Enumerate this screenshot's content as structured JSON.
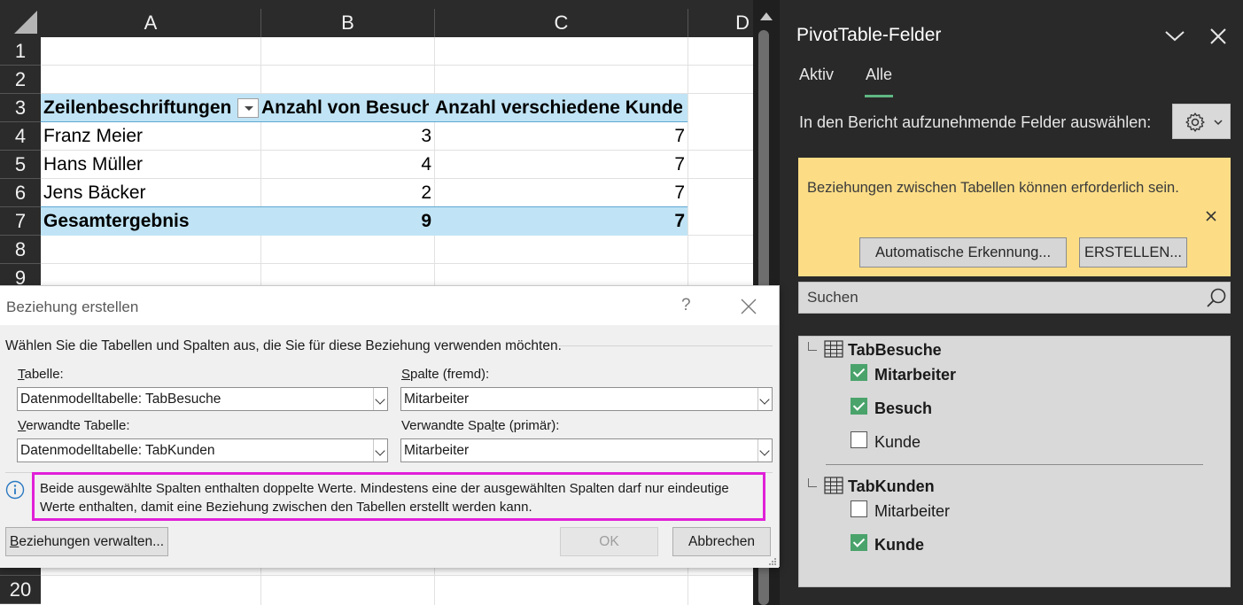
{
  "sheet": {
    "columns": [
      "A",
      "B",
      "C",
      "D"
    ],
    "rows_top": [
      "1",
      "2",
      "3",
      "4",
      "5",
      "6",
      "7",
      "8",
      "9"
    ],
    "rows_bottom": [
      "20"
    ],
    "pivot": {
      "header": [
        "Zeilenbeschriftungen",
        "Anzahl von Besuch",
        "Anzahl verschiedene Kunde"
      ],
      "rows": [
        {
          "name": "Franz Meier",
          "besuch": "3",
          "kunde": "7"
        },
        {
          "name": "Hans Müller",
          "besuch": "4",
          "kunde": "7"
        },
        {
          "name": "Jens Bäcker",
          "besuch": "2",
          "kunde": "7"
        }
      ],
      "total": {
        "name": "Gesamtergebnis",
        "besuch": "9",
        "kunde": "7"
      }
    }
  },
  "pane": {
    "title": "PivotTable-Felder",
    "tabs": [
      "Aktiv",
      "Alle"
    ],
    "active_tab": "Alle",
    "choose_label": "In den Bericht aufzunehmende Felder auswählen:",
    "notice": {
      "text": "Beziehungen zwischen Tabellen können erforderlich sein.",
      "auto_button": "Automatische Erkennung...",
      "create_button": "ERSTELLEN..."
    },
    "search_placeholder": "Suchen",
    "tables": [
      {
        "name": "TabBesuche",
        "fields": [
          {
            "label": "Mitarbeiter",
            "checked": true
          },
          {
            "label": "Besuch",
            "checked": true
          },
          {
            "label": "Kunde",
            "checked": false
          }
        ]
      },
      {
        "name": "TabKunden",
        "fields": [
          {
            "label": "Mitarbeiter",
            "checked": false
          },
          {
            "label": "Kunde",
            "checked": true
          }
        ]
      }
    ],
    "colors": {
      "background": "#292929",
      "notice": "#fcdd86",
      "checkbox_on": "#4aa36b",
      "tab_underline": "#5fb782"
    }
  },
  "dialog": {
    "title": "Beziehung erstellen",
    "help": "?",
    "intro": "Wählen Sie die Tabellen und Spalten aus, die Sie für diese Beziehung verwenden möchten.",
    "table_label_key": "T",
    "table_label_rest": "abelle:",
    "table_value": "Datenmodelltabelle: TabBesuche",
    "column_label_key": "S",
    "column_label_rest": "palte (fremd):",
    "column_value": "Mitarbeiter",
    "rel_table_label_key": "V",
    "rel_table_label_rest": "erwandte Tabelle:",
    "rel_table_value": "Datenmodelltabelle: TabKunden",
    "rel_column_label_pre": "Verwandte Spa",
    "rel_column_label_key": "l",
    "rel_column_label_post": "te (primär):",
    "rel_column_value": "Mitarbeiter",
    "message": "Beide ausgewählte Spalten enthalten doppelte Werte. Mindestens eine der ausgewählten Spalten darf nur eindeutige Werte enthalten, damit eine Beziehung zwischen den Tabellen erstellt werden kann.",
    "manage_key": "B",
    "manage_rest": "eziehungen verwalten...",
    "ok": "OK",
    "cancel": "Abbrechen",
    "highlight_color": "#e020d8"
  }
}
